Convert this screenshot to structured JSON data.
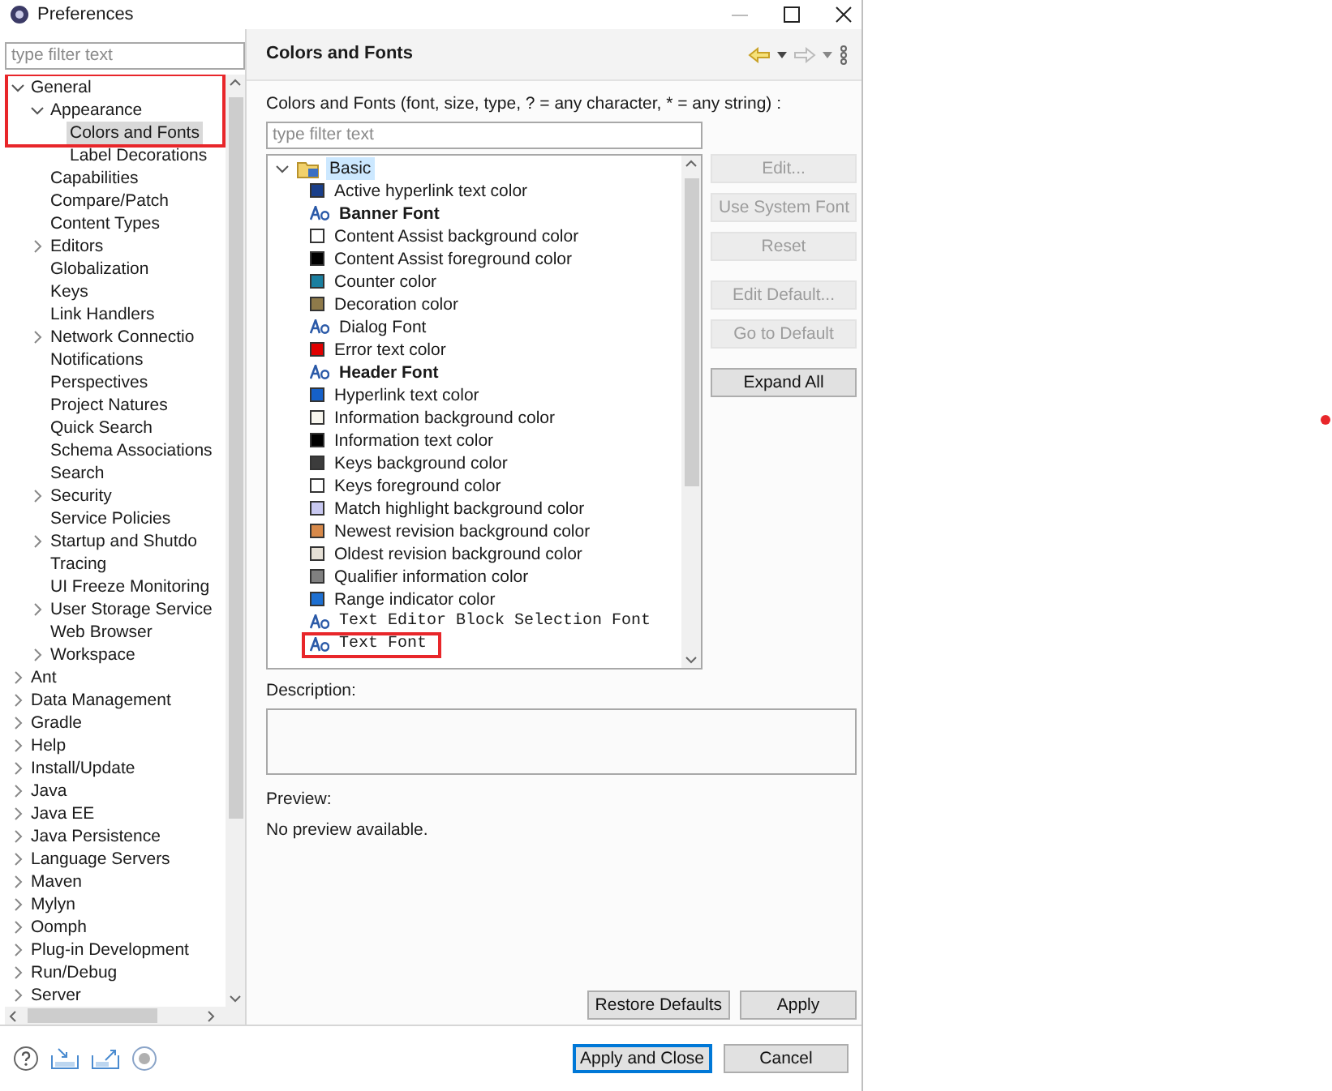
{
  "window": {
    "title": "Preferences"
  },
  "filter": {
    "placeholder": "type filter text"
  },
  "tree": [
    {
      "label": "General",
      "expanded": true,
      "selected": false,
      "highlighted": true,
      "children": [
        {
          "label": "Appearance",
          "expanded": true,
          "selected": false,
          "highlighted": true,
          "children": [
            {
              "label": "Colors and Fonts",
              "selected": true,
              "highlighted": true
            },
            {
              "label": "Label Decorations",
              "selected": false,
              "highlighted": false
            }
          ]
        },
        {
          "label": "Capabilities",
          "selected": false,
          "highlighted": false
        },
        {
          "label": "Compare/Patch",
          "selected": false,
          "highlighted": false
        },
        {
          "label": "Content Types",
          "selected": false,
          "highlighted": false
        },
        {
          "label": "Editors",
          "expanded": false,
          "selected": false,
          "highlighted": false
        },
        {
          "label": "Globalization",
          "selected": false,
          "highlighted": false
        },
        {
          "label": "Keys",
          "selected": false,
          "highlighted": false
        },
        {
          "label": "Link Handlers",
          "selected": false,
          "highlighted": false
        },
        {
          "label": "Network Connectio",
          "expanded": false,
          "selected": false,
          "highlighted": false
        },
        {
          "label": "Notifications",
          "selected": false,
          "highlighted": false
        },
        {
          "label": "Perspectives",
          "selected": false,
          "highlighted": false
        },
        {
          "label": "Project Natures",
          "selected": false,
          "highlighted": false
        },
        {
          "label": "Quick Search",
          "selected": false,
          "highlighted": false
        },
        {
          "label": "Schema Associations",
          "selected": false,
          "highlighted": false
        },
        {
          "label": "Search",
          "selected": false,
          "highlighted": false
        },
        {
          "label": "Security",
          "expanded": false,
          "selected": false,
          "highlighted": false
        },
        {
          "label": "Service Policies",
          "selected": false,
          "highlighted": false
        },
        {
          "label": "Startup and Shutdo",
          "expanded": false,
          "selected": false,
          "highlighted": false
        },
        {
          "label": "Tracing",
          "selected": false,
          "highlighted": false
        },
        {
          "label": "UI Freeze Monitoring",
          "selected": false,
          "highlighted": false
        },
        {
          "label": "User Storage Service",
          "expanded": false,
          "selected": false,
          "highlighted": false
        },
        {
          "label": "Web Browser",
          "selected": false,
          "highlighted": false
        },
        {
          "label": "Workspace",
          "expanded": false,
          "selected": false,
          "highlighted": false
        }
      ]
    },
    {
      "label": "Ant",
      "expanded": false,
      "selected": false,
      "highlighted": false
    },
    {
      "label": "Data Management",
      "expanded": false,
      "selected": false,
      "highlighted": false
    },
    {
      "label": "Gradle",
      "expanded": false,
      "selected": false,
      "highlighted": false
    },
    {
      "label": "Help",
      "expanded": false,
      "selected": false,
      "highlighted": false
    },
    {
      "label": "Install/Update",
      "expanded": false,
      "selected": false,
      "highlighted": false
    },
    {
      "label": "Java",
      "expanded": false,
      "selected": false,
      "highlighted": false
    },
    {
      "label": "Java EE",
      "expanded": false,
      "selected": false,
      "highlighted": false
    },
    {
      "label": "Java Persistence",
      "expanded": false,
      "selected": false,
      "highlighted": false
    },
    {
      "label": "Language Servers",
      "expanded": false,
      "selected": false,
      "highlighted": false
    },
    {
      "label": "Maven",
      "expanded": false,
      "selected": false,
      "highlighted": false
    },
    {
      "label": "Mylyn",
      "expanded": false,
      "selected": false,
      "highlighted": false
    },
    {
      "label": "Oomph",
      "expanded": false,
      "selected": false,
      "highlighted": false
    },
    {
      "label": "Plug-in Development",
      "expanded": false,
      "selected": false,
      "highlighted": false
    },
    {
      "label": "Run/Debug",
      "expanded": false,
      "selected": false,
      "highlighted": false
    },
    {
      "label": "Server",
      "expanded": false,
      "selected": false,
      "highlighted": false
    }
  ],
  "page": {
    "title": "Colors and Fonts",
    "filter_label": "Colors and Fonts (font, size, type, ? = any character, * = any string) :",
    "filter": {
      "placeholder": "type filter text"
    },
    "groups": [
      {
        "label": "Basic",
        "expanded": true,
        "selected": true,
        "items": [
          {
            "kind": "color",
            "label": "Active hyperlink text color",
            "color": "#1a3f8a",
            "selected": false,
            "highlighted": false
          },
          {
            "kind": "boldfont",
            "label": "Banner Font",
            "selected": false,
            "highlighted": false
          },
          {
            "kind": "color",
            "label": "Content Assist background color",
            "color": "#ffffff",
            "selected": false,
            "highlighted": false
          },
          {
            "kind": "color",
            "label": "Content Assist foreground color",
            "color": "#000000",
            "selected": false,
            "highlighted": false
          },
          {
            "kind": "color",
            "label": "Counter color",
            "color": "#1a7fa0",
            "selected": false,
            "highlighted": false
          },
          {
            "kind": "color",
            "label": "Decoration color",
            "color": "#8f7a4a",
            "selected": false,
            "highlighted": false
          },
          {
            "kind": "font",
            "label": "Dialog Font",
            "selected": false,
            "highlighted": false
          },
          {
            "kind": "color",
            "label": "Error text color",
            "color": "#e00000",
            "selected": false,
            "highlighted": false
          },
          {
            "kind": "boldfont",
            "label": "Header Font",
            "selected": false,
            "highlighted": false
          },
          {
            "kind": "color",
            "label": "Hyperlink text color",
            "color": "#1560c8",
            "selected": false,
            "highlighted": false
          },
          {
            "kind": "color",
            "label": "Information background color",
            "color": "#f8f6ee",
            "selected": false,
            "highlighted": false
          },
          {
            "kind": "color",
            "label": "Information text color",
            "color": "#000000",
            "selected": false,
            "highlighted": false
          },
          {
            "kind": "color",
            "label": "Keys background color",
            "color": "#3c3c3c",
            "selected": false,
            "highlighted": false
          },
          {
            "kind": "color",
            "label": "Keys foreground color",
            "color": "#ffffff",
            "selected": false,
            "highlighted": false
          },
          {
            "kind": "color",
            "label": "Match highlight background color",
            "color": "#c8c8f0",
            "selected": false,
            "highlighted": false
          },
          {
            "kind": "color",
            "label": "Newest revision background color",
            "color": "#d7894a",
            "selected": false,
            "highlighted": false
          },
          {
            "kind": "color",
            "label": "Oldest revision background color",
            "color": "#e6e0d6",
            "selected": false,
            "highlighted": false
          },
          {
            "kind": "color",
            "label": "Qualifier information color",
            "color": "#808080",
            "selected": false,
            "highlighted": false
          },
          {
            "kind": "color",
            "label": "Range indicator color",
            "color": "#1d6fd1",
            "selected": false,
            "highlighted": false
          },
          {
            "kind": "monofont",
            "label": "Text Editor Block Selection Font",
            "selected": false,
            "highlighted": false
          },
          {
            "kind": "monofont",
            "label": "Text Font",
            "selected": false,
            "highlighted": true
          }
        ]
      }
    ],
    "side_buttons": [
      {
        "label": "Edit...",
        "disabled": true
      },
      {
        "label": "Use System Font",
        "disabled": true
      },
      {
        "label": "Reset",
        "disabled": true
      },
      {
        "label": "Edit Default...",
        "disabled": true
      },
      {
        "label": "Go to Default",
        "disabled": true
      },
      {
        "label": "Expand All",
        "disabled": false
      }
    ],
    "description_label": "Description:",
    "preview_label": "Preview:",
    "preview_text": "No preview available.",
    "page_buttons": [
      "Restore Defaults",
      "Apply"
    ]
  },
  "dialog_buttons": [
    {
      "label": "Apply and Close",
      "default": true
    },
    {
      "label": "Cancel",
      "default": false
    }
  ],
  "annotation_dot": {
    "color": "#e8262a"
  }
}
